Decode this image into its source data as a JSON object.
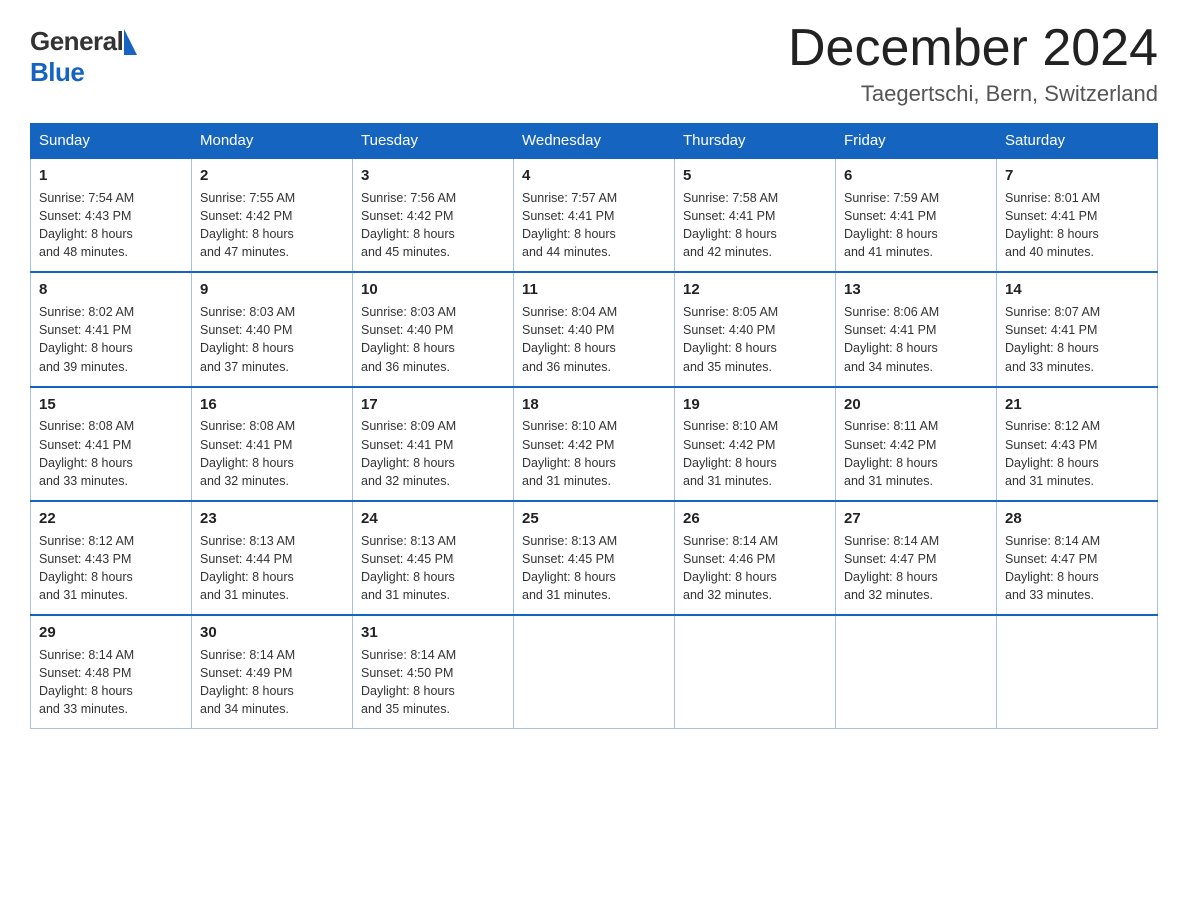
{
  "header": {
    "logo_general": "General",
    "logo_blue": "Blue",
    "month_title": "December 2024",
    "location": "Taegertschi, Bern, Switzerland"
  },
  "weekdays": [
    "Sunday",
    "Monday",
    "Tuesday",
    "Wednesday",
    "Thursday",
    "Friday",
    "Saturday"
  ],
  "weeks": [
    [
      {
        "day": "1",
        "sunrise": "7:54 AM",
        "sunset": "4:43 PM",
        "daylight": "8 hours and 48 minutes."
      },
      {
        "day": "2",
        "sunrise": "7:55 AM",
        "sunset": "4:42 PM",
        "daylight": "8 hours and 47 minutes."
      },
      {
        "day": "3",
        "sunrise": "7:56 AM",
        "sunset": "4:42 PM",
        "daylight": "8 hours and 45 minutes."
      },
      {
        "day": "4",
        "sunrise": "7:57 AM",
        "sunset": "4:41 PM",
        "daylight": "8 hours and 44 minutes."
      },
      {
        "day": "5",
        "sunrise": "7:58 AM",
        "sunset": "4:41 PM",
        "daylight": "8 hours and 42 minutes."
      },
      {
        "day": "6",
        "sunrise": "7:59 AM",
        "sunset": "4:41 PM",
        "daylight": "8 hours and 41 minutes."
      },
      {
        "day": "7",
        "sunrise": "8:01 AM",
        "sunset": "4:41 PM",
        "daylight": "8 hours and 40 minutes."
      }
    ],
    [
      {
        "day": "8",
        "sunrise": "8:02 AM",
        "sunset": "4:41 PM",
        "daylight": "8 hours and 39 minutes."
      },
      {
        "day": "9",
        "sunrise": "8:03 AM",
        "sunset": "4:40 PM",
        "daylight": "8 hours and 37 minutes."
      },
      {
        "day": "10",
        "sunrise": "8:03 AM",
        "sunset": "4:40 PM",
        "daylight": "8 hours and 36 minutes."
      },
      {
        "day": "11",
        "sunrise": "8:04 AM",
        "sunset": "4:40 PM",
        "daylight": "8 hours and 36 minutes."
      },
      {
        "day": "12",
        "sunrise": "8:05 AM",
        "sunset": "4:40 PM",
        "daylight": "8 hours and 35 minutes."
      },
      {
        "day": "13",
        "sunrise": "8:06 AM",
        "sunset": "4:41 PM",
        "daylight": "8 hours and 34 minutes."
      },
      {
        "day": "14",
        "sunrise": "8:07 AM",
        "sunset": "4:41 PM",
        "daylight": "8 hours and 33 minutes."
      }
    ],
    [
      {
        "day": "15",
        "sunrise": "8:08 AM",
        "sunset": "4:41 PM",
        "daylight": "8 hours and 33 minutes."
      },
      {
        "day": "16",
        "sunrise": "8:08 AM",
        "sunset": "4:41 PM",
        "daylight": "8 hours and 32 minutes."
      },
      {
        "day": "17",
        "sunrise": "8:09 AM",
        "sunset": "4:41 PM",
        "daylight": "8 hours and 32 minutes."
      },
      {
        "day": "18",
        "sunrise": "8:10 AM",
        "sunset": "4:42 PM",
        "daylight": "8 hours and 31 minutes."
      },
      {
        "day": "19",
        "sunrise": "8:10 AM",
        "sunset": "4:42 PM",
        "daylight": "8 hours and 31 minutes."
      },
      {
        "day": "20",
        "sunrise": "8:11 AM",
        "sunset": "4:42 PM",
        "daylight": "8 hours and 31 minutes."
      },
      {
        "day": "21",
        "sunrise": "8:12 AM",
        "sunset": "4:43 PM",
        "daylight": "8 hours and 31 minutes."
      }
    ],
    [
      {
        "day": "22",
        "sunrise": "8:12 AM",
        "sunset": "4:43 PM",
        "daylight": "8 hours and 31 minutes."
      },
      {
        "day": "23",
        "sunrise": "8:13 AM",
        "sunset": "4:44 PM",
        "daylight": "8 hours and 31 minutes."
      },
      {
        "day": "24",
        "sunrise": "8:13 AM",
        "sunset": "4:45 PM",
        "daylight": "8 hours and 31 minutes."
      },
      {
        "day": "25",
        "sunrise": "8:13 AM",
        "sunset": "4:45 PM",
        "daylight": "8 hours and 31 minutes."
      },
      {
        "day": "26",
        "sunrise": "8:14 AM",
        "sunset": "4:46 PM",
        "daylight": "8 hours and 32 minutes."
      },
      {
        "day": "27",
        "sunrise": "8:14 AM",
        "sunset": "4:47 PM",
        "daylight": "8 hours and 32 minutes."
      },
      {
        "day": "28",
        "sunrise": "8:14 AM",
        "sunset": "4:47 PM",
        "daylight": "8 hours and 33 minutes."
      }
    ],
    [
      {
        "day": "29",
        "sunrise": "8:14 AM",
        "sunset": "4:48 PM",
        "daylight": "8 hours and 33 minutes."
      },
      {
        "day": "30",
        "sunrise": "8:14 AM",
        "sunset": "4:49 PM",
        "daylight": "8 hours and 34 minutes."
      },
      {
        "day": "31",
        "sunrise": "8:14 AM",
        "sunset": "4:50 PM",
        "daylight": "8 hours and 35 minutes."
      },
      null,
      null,
      null,
      null
    ]
  ],
  "labels": {
    "sunrise": "Sunrise:",
    "sunset": "Sunset:",
    "daylight": "Daylight:"
  }
}
